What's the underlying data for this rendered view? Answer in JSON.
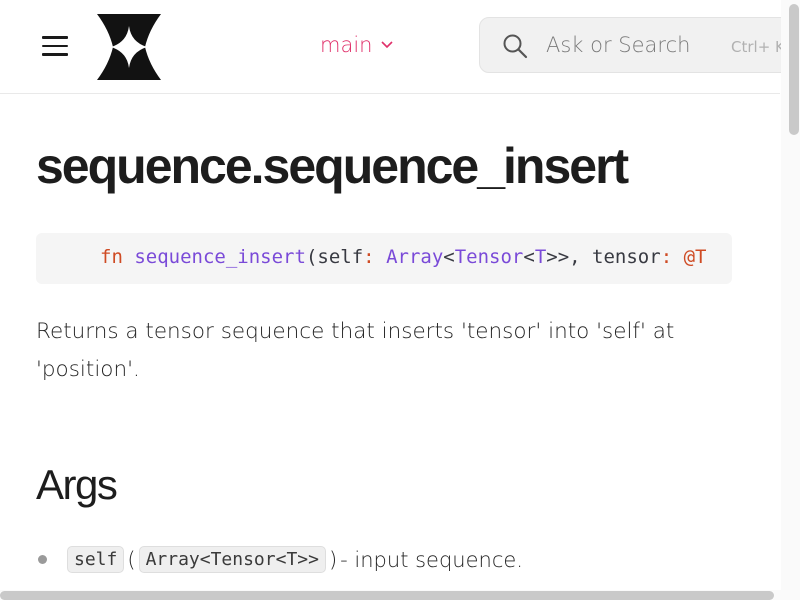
{
  "header": {
    "branch_label": "main",
    "search_placeholder": "Ask or Search",
    "search_shortcut": "Ctrl+ K"
  },
  "page": {
    "title": "sequence.sequence_insert",
    "signature": {
      "keyword": "fn",
      "function_name": "sequence_insert",
      "open_paren": "(",
      "param1": "self",
      "colon1": ":",
      "type1_outer": "Array",
      "lt1": "<",
      "type1_inner": "Tensor",
      "lt2": "<",
      "type1_generic": "T",
      "gt_close": ">>,",
      "param2": "tensor",
      "colon2": ":",
      "at_sign": "@T"
    },
    "description": "Returns a tensor sequence that inserts 'tensor' into 'self' at 'position'.",
    "args_heading": "Args",
    "args": [
      {
        "name": "self",
        "open_paren": "(",
        "type": "Array<Tensor<T>>",
        "close_paren": ")",
        "desc": " - input sequence."
      }
    ]
  },
  "icons": {
    "menu": "hamburger-menu-icon",
    "logo": "four-point-star-logo",
    "branch_chevron": "chevron-down-icon",
    "search": "magnifier-icon"
  },
  "colors": {
    "accent": "#e0306a",
    "keyword": "#cf4b24",
    "function": "#7a4ad8",
    "code_background": "#f5f5f5"
  }
}
